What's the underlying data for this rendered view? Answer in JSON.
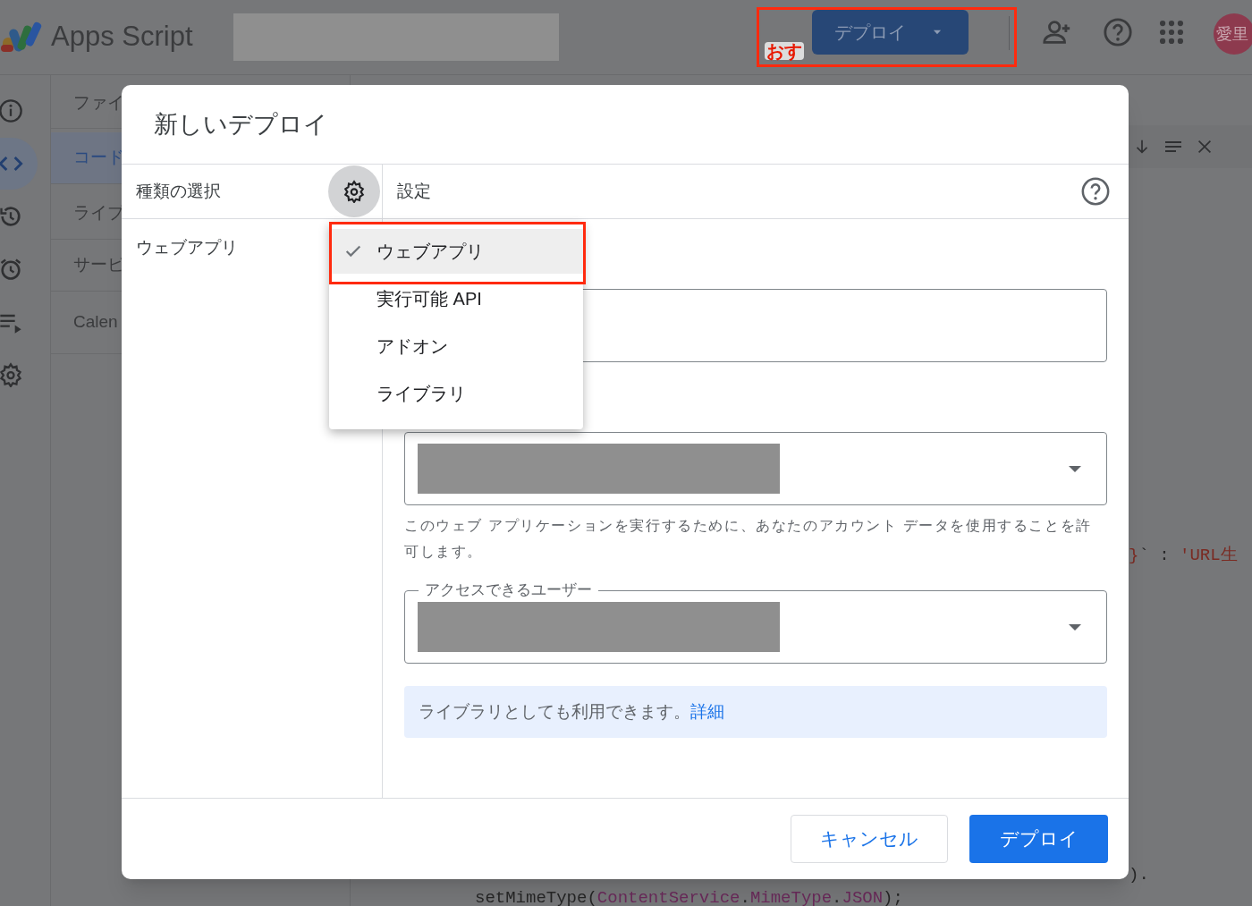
{
  "header": {
    "title": "Apps Script",
    "deploy_button": "デプロイ",
    "annotation": "おす",
    "avatar": "愛里"
  },
  "rail_items": [
    {
      "kind": "info",
      "selected": false
    },
    {
      "kind": "code",
      "selected": true
    },
    {
      "kind": "history",
      "selected": false
    },
    {
      "kind": "alarm",
      "selected": false
    },
    {
      "kind": "executions",
      "selected": false
    },
    {
      "kind": "settings",
      "selected": false
    }
  ],
  "file_panel": [
    {
      "label": "ファイ",
      "selected": false
    },
    {
      "label": "コード",
      "selected": true
    },
    {
      "label": "ライブ",
      "selected": false
    },
    {
      "label": "サービ",
      "selected": false
    },
    {
      "label": "Calen",
      "selected": false
    }
  ],
  "code_lines": [
    [
      {
        "text": "}",
        "kind": "string"
      },
      {
        "text": "`  :  ",
        "kind": "plain"
      },
      {
        "text": "'URL生",
        "kind": "string"
      }
    ],
    [
      {
        "text": ").",
        "kind": "plain"
      }
    ],
    [
      {
        "text": "setMimeType(",
        "kind": "plain"
      },
      {
        "text": "ContentService",
        "kind": "class"
      },
      {
        "text": ".",
        "kind": "plain"
      },
      {
        "text": "MimeType",
        "kind": "class"
      },
      {
        "text": ".",
        "kind": "plain"
      },
      {
        "text": "JSON",
        "kind": "class"
      },
      {
        "text": ");",
        "kind": "plain"
      }
    ]
  ],
  "dialog": {
    "title": "新しいデプロイ",
    "type_header": "種類の選択",
    "types": [
      "ウェブアプリ"
    ],
    "settings_header": "設定",
    "type_menu": [
      {
        "label": "ウェブアプリ",
        "selected": true
      },
      {
        "label": "実行可能 API",
        "selected": false
      },
      {
        "label": "アドオン",
        "selected": false
      },
      {
        "label": "ライブラリ",
        "selected": false
      }
    ],
    "execute_as": {
      "helper": "このウェブ アプリケーションを実行するために、あなたのアカウント データを使用することを許可します。"
    },
    "access": {
      "label": "アクセスできるユーザー"
    },
    "banner": {
      "text": "ライブラリとしても利用できます。",
      "link": "詳細"
    },
    "buttons": [
      {
        "label": "キャンセル",
        "kind": "secondary"
      },
      {
        "label": "デプロイ",
        "kind": "primary"
      }
    ]
  }
}
